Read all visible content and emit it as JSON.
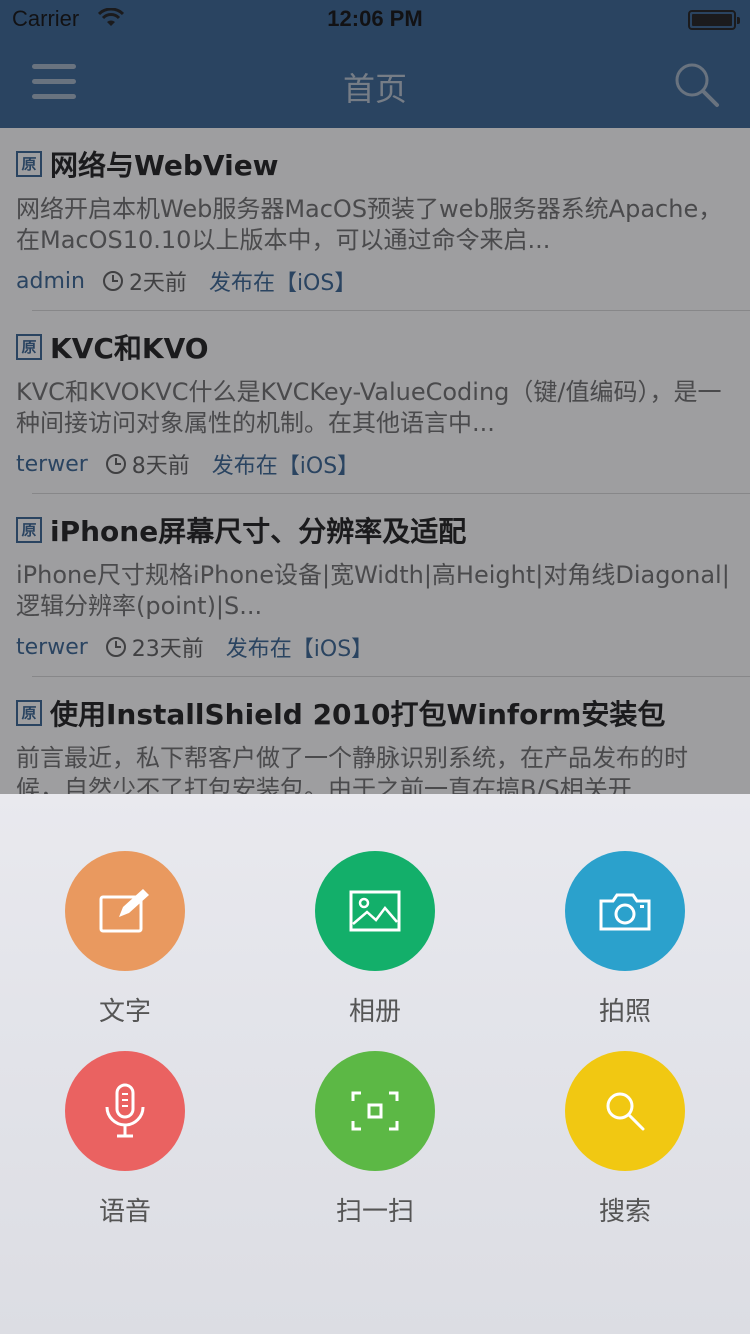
{
  "status_bar": {
    "carrier": "Carrier",
    "time": "12:06 PM"
  },
  "nav": {
    "title": "首页"
  },
  "articles": [
    {
      "tag": "原",
      "title": "网络与WebView",
      "excerpt": "网络开启本机Web服务器MacOS预装了web服务器系统Apache，在MacOS10.10以上版本中，可以通过命令来启...",
      "author": "admin",
      "time": "2天前",
      "category": "发布在【iOS】"
    },
    {
      "tag": "原",
      "title": "KVC和KVO",
      "excerpt": "KVC和KVOKVC什么是KVCKey-ValueCoding（键/值编码），是一种间接访问对象属性的机制。在其他语言中...",
      "author": "terwer",
      "time": "8天前",
      "category": "发布在【iOS】"
    },
    {
      "tag": "原",
      "title": "iPhone屏幕尺寸、分辨率及适配",
      "excerpt": "iPhone尺寸规格iPhone设备|宽Width|高Height|对角线Diagonal|逻辑分辨率(point)|S...",
      "author": "terwer",
      "time": "23天前",
      "category": "发布在【iOS】"
    },
    {
      "tag": "原",
      "title": "使用InstallShield 2010打包Winform安装包",
      "excerpt": "前言最近，私下帮客户做了一个静脉识别系统，在产品发布的时候，自然少不了打包安装包。由于之前一直在搞B/S相关开",
      "author": "",
      "time": "",
      "category": ""
    }
  ],
  "actions": [
    {
      "label": "文字",
      "icon": "edit-icon",
      "color": "#e9995f"
    },
    {
      "label": "相册",
      "icon": "image-icon",
      "color": "#13af6a"
    },
    {
      "label": "拍照",
      "icon": "camera-icon",
      "color": "#2ba1cc"
    },
    {
      "label": "语音",
      "icon": "microphone-icon",
      "color": "#ea6261"
    },
    {
      "label": "扫一扫",
      "icon": "scan-icon",
      "color": "#5cb845"
    },
    {
      "label": "搜索",
      "icon": "search-icon",
      "color": "#f1c812"
    }
  ]
}
